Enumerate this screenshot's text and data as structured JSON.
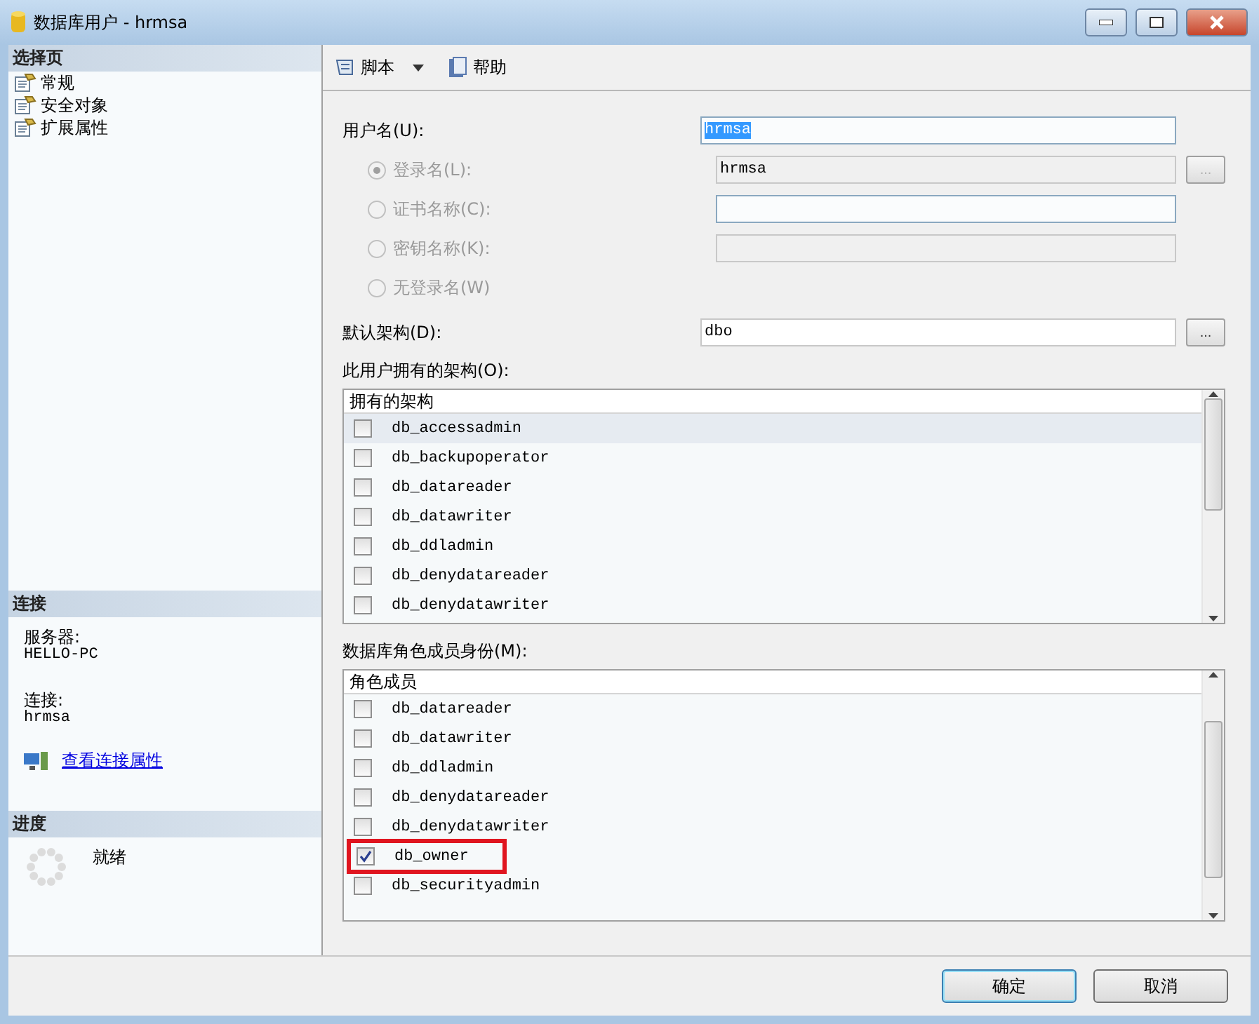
{
  "window": {
    "title": "数据库用户 - hrmsa"
  },
  "sidebar": {
    "select_page_header": "选择页",
    "pages": [
      {
        "label": "常规"
      },
      {
        "label": "安全对象"
      },
      {
        "label": "扩展属性"
      }
    ],
    "connection_header": "连接",
    "server_label": "服务器:",
    "server_value": "HELLO-PC",
    "connection_label": "连接:",
    "connection_value": "hrmsa",
    "link": "查看连接属性",
    "progress_header": "进度",
    "progress_status": "就绪"
  },
  "toolbar": [
    {
      "label": "脚本",
      "kind": "dropdown"
    },
    {
      "label": "帮助",
      "kind": "button"
    }
  ],
  "user_name": {
    "label": "用户名(U):",
    "value": "hrmsa"
  },
  "user_types": [
    {
      "label": "登录名(L):",
      "selected": true,
      "disabled": true,
      "value": "hrmsa",
      "browse": "..."
    },
    {
      "label": "证书名称(C):",
      "selected": false,
      "disabled": true
    },
    {
      "label": "密钥名称(K):",
      "selected": false,
      "disabled": true
    },
    {
      "label": "无登录名(W)",
      "selected": false,
      "disabled": true
    }
  ],
  "default_schema": {
    "label": "默认架构(D):",
    "value": "dbo",
    "browse": "..."
  },
  "owned_schemas": {
    "label": "此用户拥有的架构(O):",
    "column": "拥有的架构",
    "items": [
      {
        "name": "db_accessadmin",
        "checked": false,
        "selected": true
      },
      {
        "name": "db_backupoperator",
        "checked": false,
        "selected": false
      },
      {
        "name": "db_datareader",
        "checked": false,
        "selected": false
      },
      {
        "name": "db_datawriter",
        "checked": false,
        "selected": false
      },
      {
        "name": "db_ddladmin",
        "checked": false,
        "selected": false
      },
      {
        "name": "db_denydatareader",
        "checked": false,
        "selected": false
      },
      {
        "name": "db_denydatawriter",
        "checked": false,
        "selected": false
      }
    ]
  },
  "role_members": {
    "label": "数据库角色成员身份(M):",
    "column": "角色成员",
    "items": [
      {
        "name": "db_datareader",
        "checked": false,
        "highlighted": false
      },
      {
        "name": "db_datawriter",
        "checked": false,
        "highlighted": false
      },
      {
        "name": "db_ddladmin",
        "checked": false,
        "highlighted": false
      },
      {
        "name": "db_denydatareader",
        "checked": false,
        "highlighted": false
      },
      {
        "name": "db_denydatawriter",
        "checked": false,
        "highlighted": false
      },
      {
        "name": "db_owner",
        "checked": true,
        "highlighted": true
      },
      {
        "name": "db_securityadmin",
        "checked": false,
        "highlighted": false
      }
    ]
  },
  "buttons": [
    {
      "label": "确定",
      "default": true
    },
    {
      "label": "取消",
      "default": false
    }
  ]
}
